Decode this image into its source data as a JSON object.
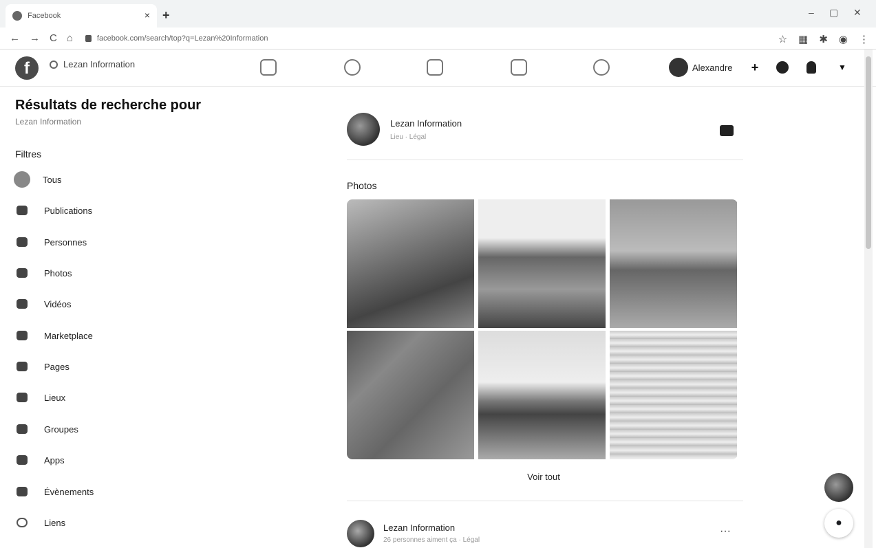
{
  "browser": {
    "tab_title": "Facebook",
    "tab_close": "×",
    "new_tab": "+",
    "url": "facebook.com/search/top?q=Lezan%20Information",
    "nav": {
      "back": "←",
      "forward": "→",
      "reload": "C",
      "home": "⌂"
    },
    "window": {
      "minimize": "–",
      "maximize": "▢",
      "close": "✕"
    },
    "toolbar_icons": [
      "star-icon",
      "extension-icon",
      "puzzle-icon",
      "profile-icon",
      "menu-icon"
    ],
    "toolbar_glyphs": [
      "☆",
      "▦",
      "✱",
      "◉",
      "⋮"
    ]
  },
  "header": {
    "search_text": "Lezan Information",
    "profile_name": "Alexandre",
    "create": "+"
  },
  "sidebar": {
    "title": "Résultats de recherche pour",
    "subtitle": "Lezan Information",
    "filters_label": "Filtres",
    "items": [
      {
        "label": "Tous",
        "icon": "all-icon"
      },
      {
        "label": "Publications",
        "icon": "posts-icon"
      },
      {
        "label": "Personnes",
        "icon": "people-icon"
      },
      {
        "label": "Photos",
        "icon": "photos-icon"
      },
      {
        "label": "Vidéos",
        "icon": "videos-icon"
      },
      {
        "label": "Marketplace",
        "icon": "marketplace-icon"
      },
      {
        "label": "Pages",
        "icon": "pages-icon"
      },
      {
        "label": "Lieux",
        "icon": "places-icon"
      },
      {
        "label": "Groupes",
        "icon": "groups-icon"
      },
      {
        "label": "Apps",
        "icon": "apps-icon"
      },
      {
        "label": "Évènements",
        "icon": "events-icon"
      },
      {
        "label": "Liens",
        "icon": "links-icon"
      }
    ]
  },
  "main": {
    "result1": {
      "name": "Lezan Information",
      "meta": "Lieu · Légal"
    },
    "photos_label": "Photos",
    "see_all": "Voir tout",
    "result2": {
      "name": "Lezan Information",
      "meta": "26 personnes aiment ça · Légal",
      "more": "···"
    }
  }
}
